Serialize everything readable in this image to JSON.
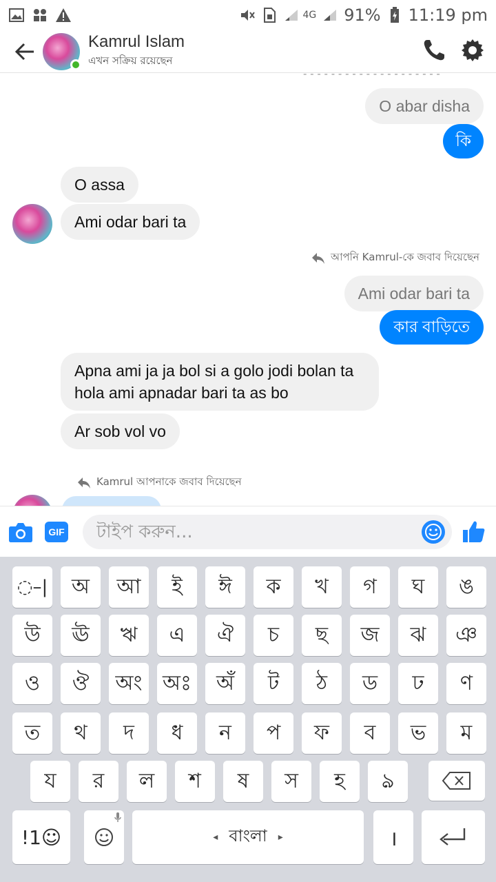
{
  "status_bar": {
    "left_icons": [
      "image-icon",
      "apps-icon",
      "warning-icon"
    ],
    "network": "4G",
    "battery": "91%",
    "time": "11:19 pm"
  },
  "header": {
    "contact_name": "Kamrul Islam",
    "contact_status": "এখন সক্রিয় রয়েছেন",
    "icons": [
      "back-arrow-icon",
      "phone-icon",
      "gear-icon"
    ]
  },
  "chat": {
    "messages": [
      {
        "side": "out-quote",
        "text": "O abar disha"
      },
      {
        "side": "out",
        "text": "কি"
      },
      {
        "side": "in",
        "text": "O assa"
      },
      {
        "side": "in",
        "text": "Ami odar bari ta"
      },
      {
        "side": "note",
        "text": "আপনি Kamrul-কে জবাব দিয়েছেন"
      },
      {
        "side": "out-quote",
        "text": "Ami odar bari ta"
      },
      {
        "side": "out",
        "text": "কার বাড়িতে"
      },
      {
        "side": "in",
        "text": "Apna ami ja ja bol si a golo jodi bolan ta hola ami apnadar bari ta as bo"
      },
      {
        "side": "in",
        "text": "Ar sob vol vo"
      },
      {
        "side": "note",
        "text": "Kamrul আপনাকে জবাব দিয়েছেন"
      }
    ]
  },
  "composer": {
    "placeholder": "টাইপ করুন...",
    "gif_label": "GIF"
  },
  "keyboard": {
    "rows": [
      [
        "◌‌–|",
        "অ",
        "আ",
        "ই",
        "ঈ",
        "ক",
        "খ",
        "গ",
        "ঘ",
        "ঙ"
      ],
      [
        "উ",
        "ঊ",
        "ঋ",
        "এ",
        "ঐ",
        "চ",
        "ছ",
        "জ",
        "ঝ",
        "ঞ"
      ],
      [
        "ও",
        "ঔ",
        "অং",
        "অঃ",
        "অঁ",
        "ট",
        "ঠ",
        "ড",
        "ঢ",
        "ণ"
      ],
      [
        "ত",
        "থ",
        "দ",
        "ধ",
        "ন",
        "প",
        "ফ",
        "ব",
        "ভ",
        "ম"
      ],
      [
        "য",
        "র",
        "ল",
        "শ",
        "ষ",
        "স",
        "হ",
        "ঌ"
      ]
    ],
    "symbols_label": "!1☺",
    "space_label": "বাংলা",
    "period_label": "।"
  }
}
